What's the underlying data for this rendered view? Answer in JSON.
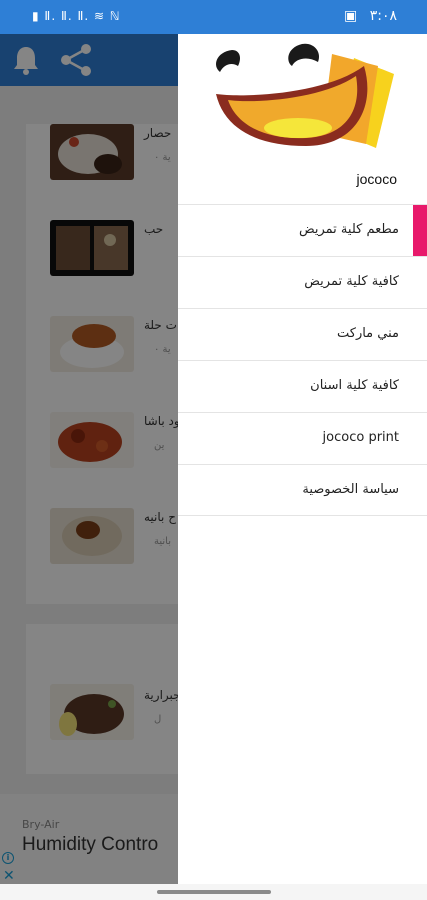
{
  "status_bar": {
    "left_indicators": "▮ Ⅱ. Ⅱ. Ⅱ. ≋ ℕ",
    "time": "٣:٠٨"
  },
  "colors": {
    "primary": "#2e7fd6",
    "accent": "#e8196b",
    "scrim": "rgba(0,0,0,0.48)"
  },
  "app_bar": {
    "icons": [
      "bell-icon",
      "share-icon"
    ]
  },
  "background_items": [
    {
      "title": "حصار",
      "sub": "ية ٠"
    },
    {
      "title": "حب",
      "sub": ""
    },
    {
      "title": "ت حلة",
      "sub": "ية ٠"
    },
    {
      "title": "ود باشا",
      "sub": "ين"
    },
    {
      "title": "ح بانيه",
      "sub": "بانية"
    },
    {
      "title": "جبرارية",
      "sub": "ل"
    }
  ],
  "ad": {
    "brand": "Bry-Air",
    "title": "Humidity Contro",
    "info_icon": "info-icon",
    "close_icon": "close-icon"
  },
  "drawer": {
    "title": "jococo",
    "menu": [
      {
        "label": "مطعم كلية تمريض",
        "active": true
      },
      {
        "label": "كافية كلية تمريض",
        "active": false
      },
      {
        "label": "مني ماركت",
        "active": false
      },
      {
        "label": "كافية كلية اسنان",
        "active": false
      },
      {
        "label": "jococo print",
        "active": false
      },
      {
        "label": "سياسة الخصوصية",
        "active": false
      }
    ]
  }
}
